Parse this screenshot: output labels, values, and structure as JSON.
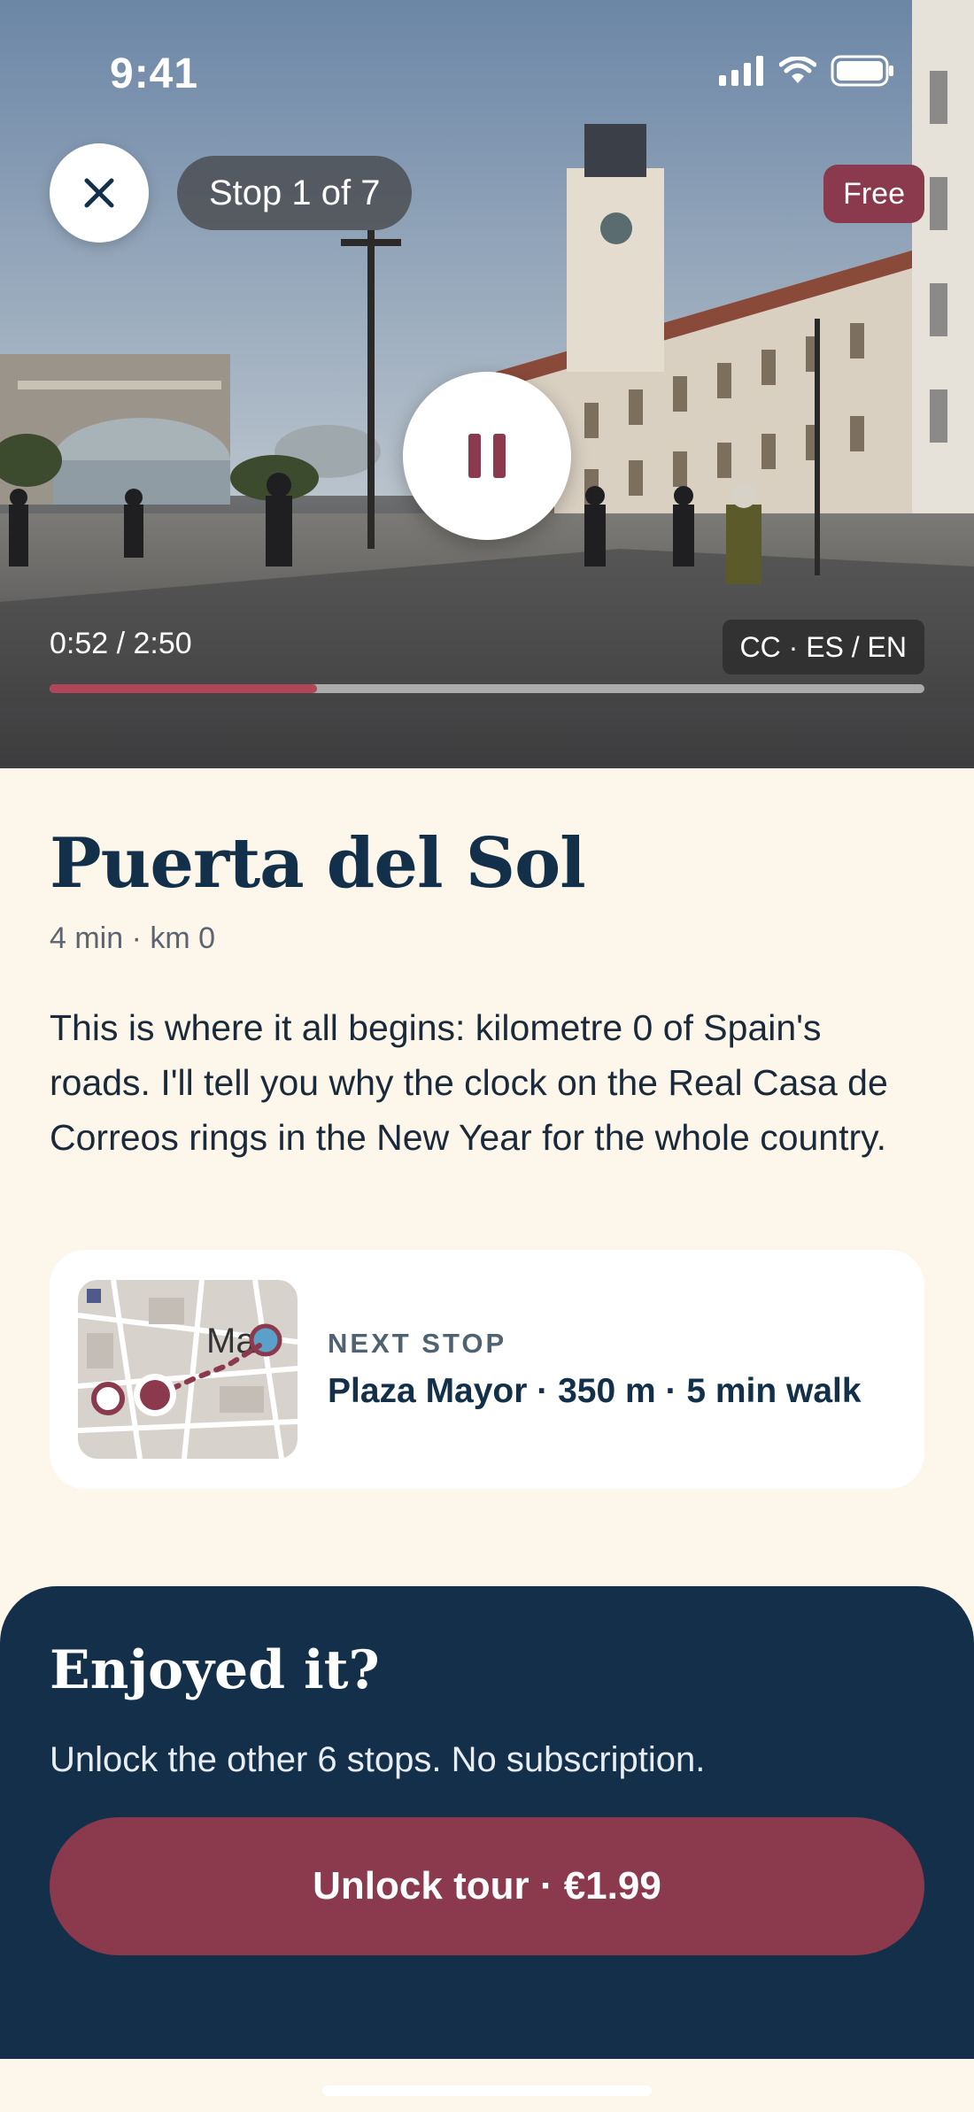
{
  "status_bar": {
    "time": "9:41"
  },
  "player": {
    "stop_indicator": "Stop 1 of 7",
    "badge": "Free",
    "time_display": "0:52 / 2:50",
    "subtitles": "CC · ES / EN",
    "progress": 0.306
  },
  "stop": {
    "title": "Puerta del Sol",
    "meta": "4 min · km 0",
    "description": "This is where it all begins: kilometre 0 of Spain's roads. I'll tell you why the clock on the Real Casa de Correos rings in the New Year for the whole country."
  },
  "next_stop": {
    "label": "NEXT STOP",
    "value": "Plaza Mayor · 350 m · 5 min walk"
  },
  "upsell": {
    "title": "Enjoyed it?",
    "subtitle": "Unlock the other 6 stops. No subscription.",
    "button": "Unlock tour · €1.99"
  },
  "colors": {
    "accent": "#8a3a4c",
    "navy": "#132f4a",
    "background": "#fdf6ea"
  },
  "icons": [
    "close-icon",
    "pause-icon",
    "signal-icon",
    "wifi-icon",
    "battery-icon",
    "map-thumbnail"
  ]
}
